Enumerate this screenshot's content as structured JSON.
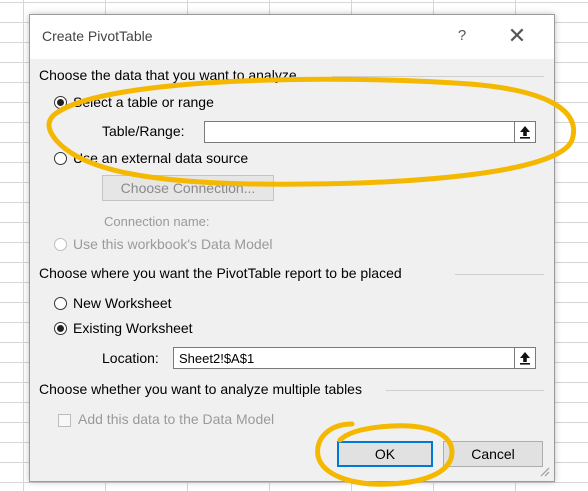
{
  "dialog": {
    "title": "Create PivotTable",
    "help_label": "?",
    "close_label": "✕"
  },
  "source_section": {
    "heading": "Choose the data that you want to analyze",
    "option_table_range": "Select a table or range",
    "table_range_label": "Table/Range:",
    "table_range_value": "",
    "option_external": "Use an external data source",
    "choose_connection_label": "Choose Connection...",
    "connection_name_label": "Connection name:",
    "option_data_model": "Use this workbook's Data Model"
  },
  "placement_section": {
    "heading": "Choose where you want the PivotTable report to be placed",
    "option_new_worksheet": "New Worksheet",
    "option_existing_worksheet": "Existing Worksheet",
    "location_label": "Location:",
    "location_value": "Sheet2!$A$1"
  },
  "multiple_tables_section": {
    "heading": "Choose whether you want to analyze multiple tables",
    "add_to_data_model_label": "Add this data to the Data Model"
  },
  "buttons": {
    "ok_label": "OK",
    "cancel_label": "Cancel"
  },
  "colors": {
    "annotation": "#f5b800",
    "default_button_border": "#0078d7",
    "dialog_background": "#f0f0f0"
  },
  "icons": [
    "collapse-dialog-icon",
    "resize-grip-icon"
  ]
}
